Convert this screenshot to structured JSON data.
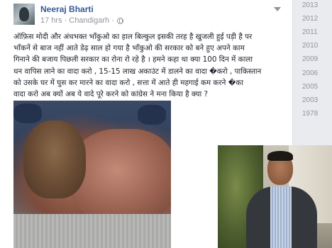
{
  "post": {
    "author": "Neeraj Bharti",
    "time": "17 hrs",
    "separator": "·",
    "location": "Chandigarh",
    "lines": [
      "ऑफ़िस मोदी और अंधभक्त भाँकुओ का हाल बिल्कुल इसकी तरह है खुजली हुई पड़ी है पर",
      "भाँकनें से बाज नहीं आते डेढ़ साल हो गया है भाँकुओ की सरकार को बने हुए अपने काम",
      "गिनाने की बजाय पिछली सरकार का रोना रो रहे है । हमने कहा था क्या 100 दिन में काला",
      "धन वापिस लाने का वादा करो , 15-15 लाख अकाउंट में डालने का वादा �करो , पाकिस्तान",
      "को उसके घर में घुस कर मारने का वादा करो , सत्ता में आते ही महगाई कम करने �का",
      "वादा करो अब क्यों अब ये वादे पूरे करने को कांग्रेस ने मना किया है क्या ?"
    ]
  },
  "year_nav": [
    "2013",
    "2012",
    "2011",
    "2010",
    "2009",
    "2006",
    "2005",
    "2003",
    "1978"
  ]
}
